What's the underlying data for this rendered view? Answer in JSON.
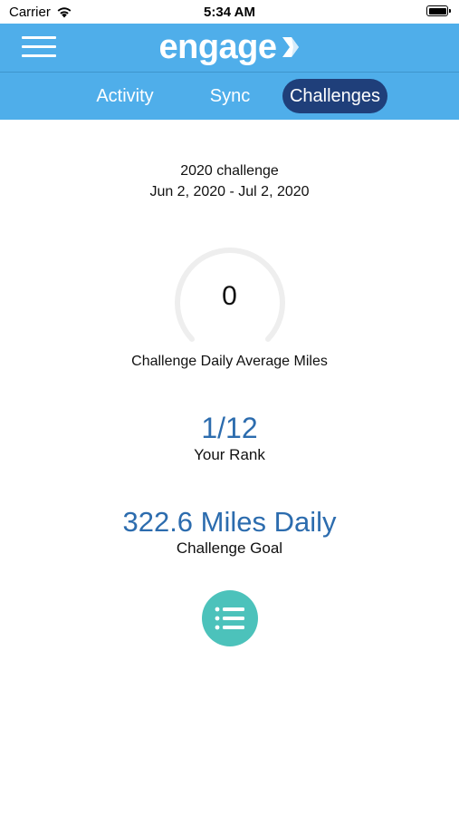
{
  "status_bar": {
    "carrier": "Carrier",
    "time": "5:34 AM"
  },
  "header": {
    "logo_text": "engage",
    "menu_icon": "hamburger-menu-icon"
  },
  "tabs": [
    {
      "label": "Activity",
      "active": false
    },
    {
      "label": "Sync",
      "active": false
    },
    {
      "label": "Challenges",
      "active": true
    }
  ],
  "challenge": {
    "name": "2020 challenge",
    "dates": "Jun 2, 2020 - Jul 2, 2020",
    "daily_average_value": "0",
    "daily_average_label": "Challenge Daily Average Miles",
    "rank_value": "1/12",
    "rank_label": "Your Rank",
    "goal_value": "322.6 Miles Daily",
    "goal_label": "Challenge Goal"
  },
  "actions": {
    "list_icon": "list-icon"
  },
  "colors": {
    "header_bg": "#4faeea",
    "active_tab_bg": "#1f3f7a",
    "stat_blue": "#2c6cae",
    "action_button": "#4cc2bb",
    "gauge_track": "#eeeeee"
  }
}
